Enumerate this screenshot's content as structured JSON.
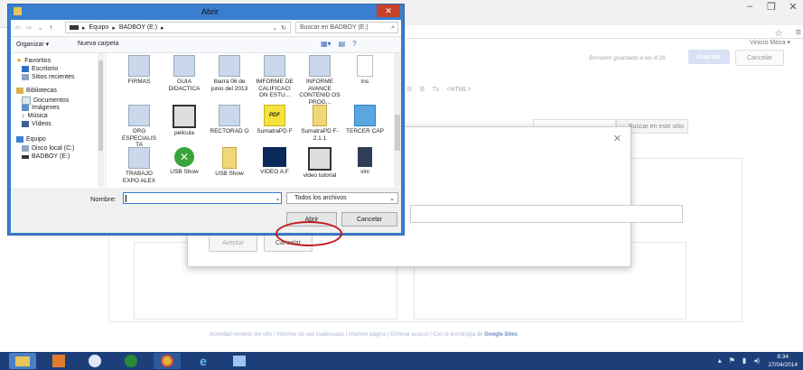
{
  "browser": {
    "user": "Vinicio Meza ▾",
    "draft_status": "Borrador guardado a las 8:26",
    "save_label": "Guardar",
    "cancel_label": "Cancelar",
    "toolbar_html": "<HTML>",
    "site_search_label": "Buscar en este sitio",
    "footer": "Actividad reciente del sitio  |  Informar de uso inadecuado  |  Imprimir página  |  Eliminar acceso  |  Con la tecnología de",
    "footer_brand": "Google Sites"
  },
  "web_dialog": {
    "accept_label": "Aceptar",
    "cancel_label": "Cancelar"
  },
  "dialog": {
    "title": "Abrir",
    "crumb_1": "Equipo",
    "crumb_2": "BADBOY (E:)",
    "search_placeholder": "Buscar en BADBOY (E:)",
    "organize": "Organizar ▾",
    "new_folder": "Nueva carpeta",
    "nav": [
      {
        "label": "Favoritos"
      },
      {
        "label": "Escritorio"
      },
      {
        "label": "Sitios recientes"
      },
      {
        "label": "Bibliotecas"
      },
      {
        "label": "Documentos"
      },
      {
        "label": "Imágenes"
      },
      {
        "label": "Música"
      },
      {
        "label": "Vídeos"
      },
      {
        "label": "Equipo"
      },
      {
        "label": "Disco local (C:)"
      },
      {
        "label": "BADBOY (E:)"
      }
    ],
    "files": [
      {
        "label": "FIRMAS"
      },
      {
        "label": "GUIA DIDACTICA"
      },
      {
        "label": "Ibarra 06 de junio del 2013"
      },
      {
        "label": "IMFORME DE CALIFICACI ON ESTU..."
      },
      {
        "label": "INFORME AVANCE CONTENID OS PROG..."
      },
      {
        "label": "ins"
      },
      {
        "label": "ORG ESPECIALIS TA"
      },
      {
        "label": "pelicula"
      },
      {
        "label": "RECTORAD O"
      },
      {
        "label": "SumatraPD F"
      },
      {
        "label": "SumatraPD F-2.1.1"
      },
      {
        "label": "TERCER CAP"
      },
      {
        "label": "TRABAJO EXPO ALEX"
      },
      {
        "label": "USB Show"
      },
      {
        "label": "USB Show"
      },
      {
        "label": "VIDEO A.F"
      },
      {
        "label": "video tutorial"
      },
      {
        "label": "vini"
      }
    ],
    "name_label": "Nombre:",
    "filter_label": "Todos los archivos",
    "open_label": "Abrir",
    "cancel_label": "Cancelar"
  },
  "taskbar": {
    "time": "8:34",
    "date": "27/04/2014"
  }
}
